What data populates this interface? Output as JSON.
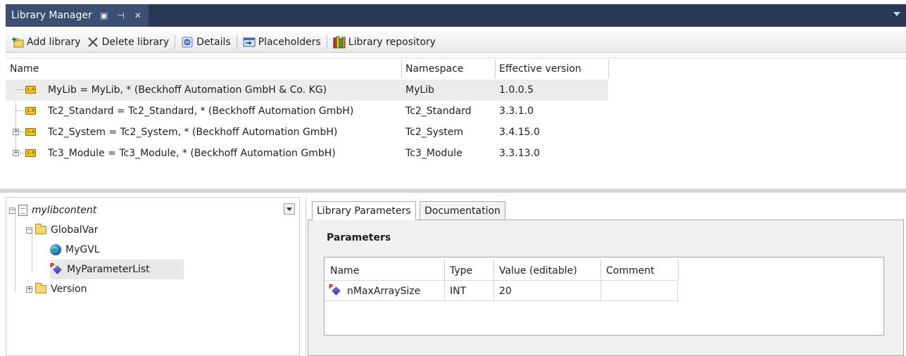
{
  "window": {
    "title": "Library Manager",
    "pin_icon": "float-window-icon",
    "autohide_icon": "pin-icon",
    "close_icon": "close-icon"
  },
  "toolbar": {
    "add_library": "Add library",
    "delete_library": "Delete library",
    "details": "Details",
    "placeholders": "Placeholders",
    "library_repository": "Library repository"
  },
  "libraries": {
    "headers": {
      "name": "Name",
      "namespace": "Namespace",
      "effective_version": "Effective version"
    },
    "rows": [
      {
        "name": "MyLib = MyLib, * (Beckhoff Automation GmbH & Co. KG)",
        "namespace": "MyLib",
        "version": "1.0.0.5",
        "expandable": false,
        "selected": true
      },
      {
        "name": "Tc2_Standard = Tc2_Standard, * (Beckhoff Automation GmbH)",
        "namespace": "Tc2_Standard",
        "version": "3.3.1.0",
        "expandable": false,
        "selected": false
      },
      {
        "name": "Tc2_System = Tc2_System, * (Beckhoff Automation GmbH)",
        "namespace": "Tc2_System",
        "version": "3.4.15.0",
        "expandable": true,
        "selected": false
      },
      {
        "name": "Tc3_Module = Tc3_Module, * (Beckhoff Automation GmbH)",
        "namespace": "Tc3_Module",
        "version": "3.3.13.0",
        "expandable": true,
        "selected": false
      }
    ],
    "icon_label": "1.0"
  },
  "tree": {
    "root": "mylibcontent",
    "globalvar": "GlobalVar",
    "mygvl": "MyGVL",
    "myparameterlist": "MyParameterList",
    "version": "Version"
  },
  "tabs": {
    "library_parameters": "Library Parameters",
    "documentation": "Documentation"
  },
  "parameters": {
    "title": "Parameters",
    "headers": {
      "name": "Name",
      "type": "Type",
      "value": "Value (editable)",
      "comment": "Comment"
    },
    "rows": [
      {
        "name": "nMaxArraySize",
        "type": "INT",
        "value": "20",
        "comment": ""
      }
    ]
  },
  "colors": {
    "title_bar": "#293955",
    "title_tab": "#3a4f72",
    "selection": "#ececec"
  }
}
